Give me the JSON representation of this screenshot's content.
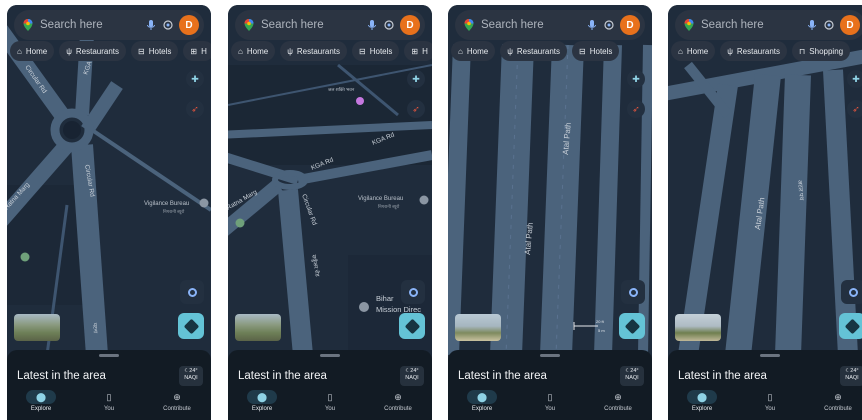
{
  "search": {
    "placeholder": "Search here",
    "avatar_letter": "D"
  },
  "sheet": {
    "title": "Latest in the area",
    "weather_temp": "24°",
    "weather_aqi": "NAQI"
  },
  "nav": [
    {
      "label": "Explore",
      "icon": "location-pin-icon"
    },
    {
      "label": "You",
      "icon": "bookmark-icon"
    },
    {
      "label": "Contribute",
      "icon": "plus-circle-icon"
    }
  ],
  "phones": [
    {
      "chips": [
        {
          "label": "Home",
          "icon": "home-icon"
        },
        {
          "label": "Restaurants",
          "icon": "restaurant-icon"
        },
        {
          "label": "Hotels",
          "icon": "hotel-icon"
        },
        {
          "label": "H",
          "icon": "more-icon"
        }
      ],
      "map_labels": {
        "circular_rd_top": "Circular Rd",
        "kgr_rd": "KGA Rd",
        "ratna_marg": "Ratna Marg",
        "circular_rd": "Circular Rd",
        "vigilance": "Vigilance Bureau",
        "vigilance_hi": "निगरानी ब्यूरो",
        "hindi_1": "पटना",
        "hindi_2": "मार्ग"
      }
    },
    {
      "chips": [
        {
          "label": "Home",
          "icon": "home-icon"
        },
        {
          "label": "Restaurants",
          "icon": "restaurant-icon"
        },
        {
          "label": "Hotels",
          "icon": "hotel-icon"
        },
        {
          "label": "H",
          "icon": "more-icon"
        }
      ],
      "map_labels": {
        "kgr_rd": "KGA Rd",
        "kgr_rd_2": "KGA Rd",
        "ratna_marg": "Ratna Marg",
        "circular_rd": "Circular Rd",
        "vigilance": "Vigilance Bureau",
        "vigilance_hi": "निगरानी ब्यूरो",
        "bihar": "Bihar",
        "mission": "Mission Direc",
        "place_hi": "जल शक्ति भवन",
        "hindi_road": "सर्कुलर रोड"
      }
    },
    {
      "chips": [
        {
          "label": "Home",
          "icon": "home-icon"
        },
        {
          "label": "Restaurants",
          "icon": "restaurant-icon"
        },
        {
          "label": "Hotels",
          "icon": "hotel-icon"
        }
      ],
      "map_labels": {
        "atal_1": "Atal Path",
        "atal_2": "Atal Path",
        "scale_1": "20 ft",
        "scale_2": "5 m"
      }
    },
    {
      "chips": [
        {
          "label": "Home",
          "icon": "home-icon"
        },
        {
          "label": "Restaurants",
          "icon": "restaurant-icon"
        },
        {
          "label": "Shopping",
          "icon": "shopping-bag-icon"
        }
      ],
      "map_labels": {
        "atal": "Atal Path",
        "atal_hi": "अटल पथ"
      }
    }
  ],
  "colors": {
    "map_bg": "#1e2a3a",
    "road": "#4d6680",
    "road_edge": "#3a5068",
    "accent": "#64c3d6",
    "avatar": "#e8711c"
  }
}
